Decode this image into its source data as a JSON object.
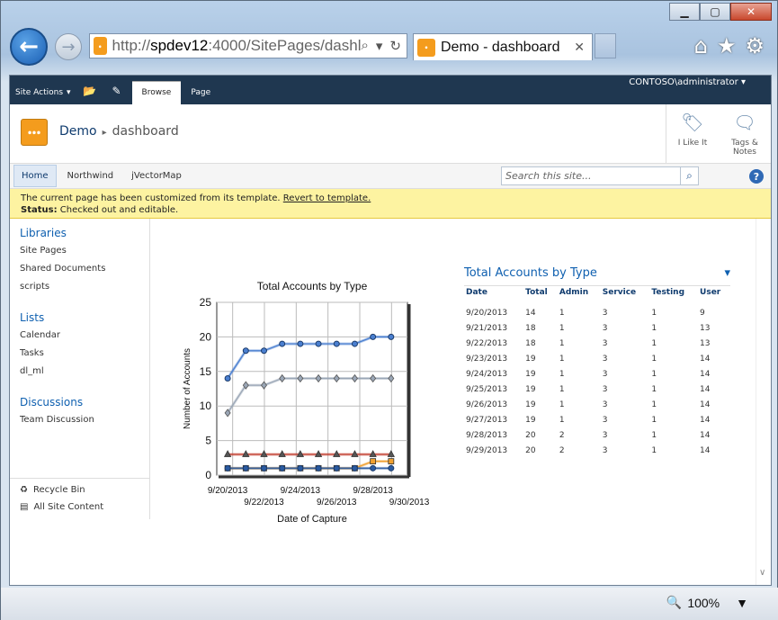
{
  "browser": {
    "url_prefix": "http://",
    "url_host": "spdev12",
    "url_rest": ":4000/SitePages/dashl",
    "tab_title": "Demo - dashboard",
    "zoom": "100%"
  },
  "ribbon": {
    "site_actions": "Site Actions",
    "tab_browse": "Browse",
    "tab_page": "Page",
    "user": "CONTOSO\\administrator"
  },
  "header": {
    "site": "Demo",
    "page": "dashboard",
    "like": "I Like It",
    "tags1": "Tags &",
    "tags2": "Notes"
  },
  "topnav": {
    "items": [
      "Home",
      "Northwind",
      "jVectorMap"
    ],
    "search_placeholder": "Search this site..."
  },
  "notice": {
    "line1": "The current page has been customized from its template.",
    "revert": "Revert to template.",
    "status_label": "Status:",
    "status_text": "Checked out and editable."
  },
  "leftnav": {
    "libraries": "Libraries",
    "lib_items": [
      "Site Pages",
      "Shared Documents",
      "scripts"
    ],
    "lists": "Lists",
    "list_items": [
      "Calendar",
      "Tasks",
      "dl_ml"
    ],
    "discussions": "Discussions",
    "disc_items": [
      "Team Discussion"
    ],
    "recycle": "Recycle Bin",
    "allsite": "All Site Content"
  },
  "table": {
    "title": "Total Accounts by Type",
    "headers": [
      "Date",
      "Total",
      "Admin",
      "Service",
      "Testing",
      "User"
    ],
    "rows": [
      [
        "9/20/2013",
        "14",
        "1",
        "3",
        "1",
        "9"
      ],
      [
        "9/21/2013",
        "18",
        "1",
        "3",
        "1",
        "13"
      ],
      [
        "9/22/2013",
        "18",
        "1",
        "3",
        "1",
        "13"
      ],
      [
        "9/23/2013",
        "19",
        "1",
        "3",
        "1",
        "14"
      ],
      [
        "9/24/2013",
        "19",
        "1",
        "3",
        "1",
        "14"
      ],
      [
        "9/25/2013",
        "19",
        "1",
        "3",
        "1",
        "14"
      ],
      [
        "9/26/2013",
        "19",
        "1",
        "3",
        "1",
        "14"
      ],
      [
        "9/27/2013",
        "19",
        "1",
        "3",
        "1",
        "14"
      ],
      [
        "9/28/2013",
        "20",
        "2",
        "3",
        "1",
        "14"
      ],
      [
        "9/29/2013",
        "20",
        "2",
        "3",
        "1",
        "14"
      ]
    ]
  },
  "chart_data": {
    "type": "line",
    "title": "Total Accounts by Type",
    "xlabel": "Date of Capture",
    "ylabel": "Number of Accounts",
    "ylim": [
      0,
      25
    ],
    "yticks": [
      0,
      5,
      10,
      15,
      20,
      25
    ],
    "xtick_labels": [
      "9/20/2013",
      "9/22/2013",
      "9/24/2013",
      "9/26/2013",
      "9/28/2013",
      "9/30/2013"
    ],
    "x": [
      "9/20/2013",
      "9/21/2013",
      "9/22/2013",
      "9/23/2013",
      "9/24/2013",
      "9/25/2013",
      "9/26/2013",
      "9/27/2013",
      "9/28/2013",
      "9/29/2013"
    ],
    "series": [
      {
        "values": [
          14,
          18,
          18,
          19,
          19,
          19,
          19,
          19,
          20,
          20
        ],
        "color": "#4a7fd0",
        "marker": "circle"
      },
      {
        "values": [
          9,
          13,
          13,
          14,
          14,
          14,
          14,
          14,
          14,
          14
        ],
        "color": "#9aa6b6",
        "marker": "diamond"
      },
      {
        "values": [
          3,
          3,
          3,
          3,
          3,
          3,
          3,
          3,
          3,
          3
        ],
        "color": "#c0392b",
        "marker": "triangle"
      },
      {
        "values": [
          1,
          1,
          1,
          1,
          1,
          1,
          1,
          1,
          2,
          2
        ],
        "color": "#f0a030",
        "marker": "square"
      },
      {
        "values": [
          1,
          1,
          1,
          1,
          1,
          1,
          1,
          1,
          1,
          1
        ],
        "color": "#2a5aa0",
        "marker": "circle"
      }
    ],
    "grid": true
  }
}
